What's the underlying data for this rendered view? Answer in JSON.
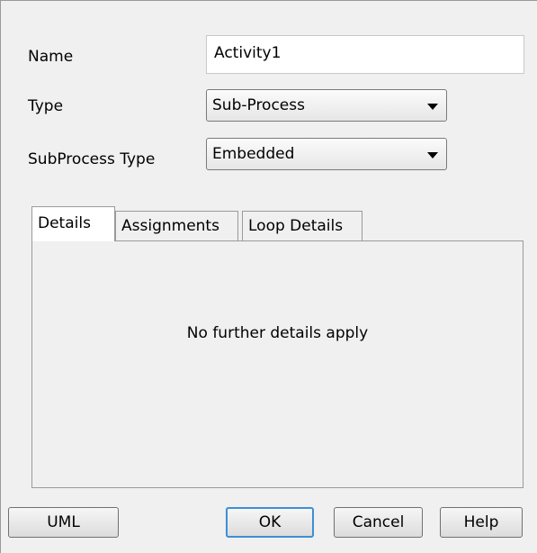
{
  "form": {
    "name_label": "Name",
    "name_value": "Activity1",
    "type_label": "Type",
    "type_value": "Sub-Process",
    "subprocess_type_label": "SubProcess Type",
    "subprocess_type_value": "Embedded"
  },
  "tabs": [
    {
      "label": "Details",
      "active": true
    },
    {
      "label": "Assignments",
      "active": false
    },
    {
      "label": "Loop Details",
      "active": false
    }
  ],
  "panel": {
    "message": "No further details apply"
  },
  "buttons": {
    "uml": "UML",
    "ok": "OK",
    "cancel": "Cancel",
    "help": "Help"
  }
}
